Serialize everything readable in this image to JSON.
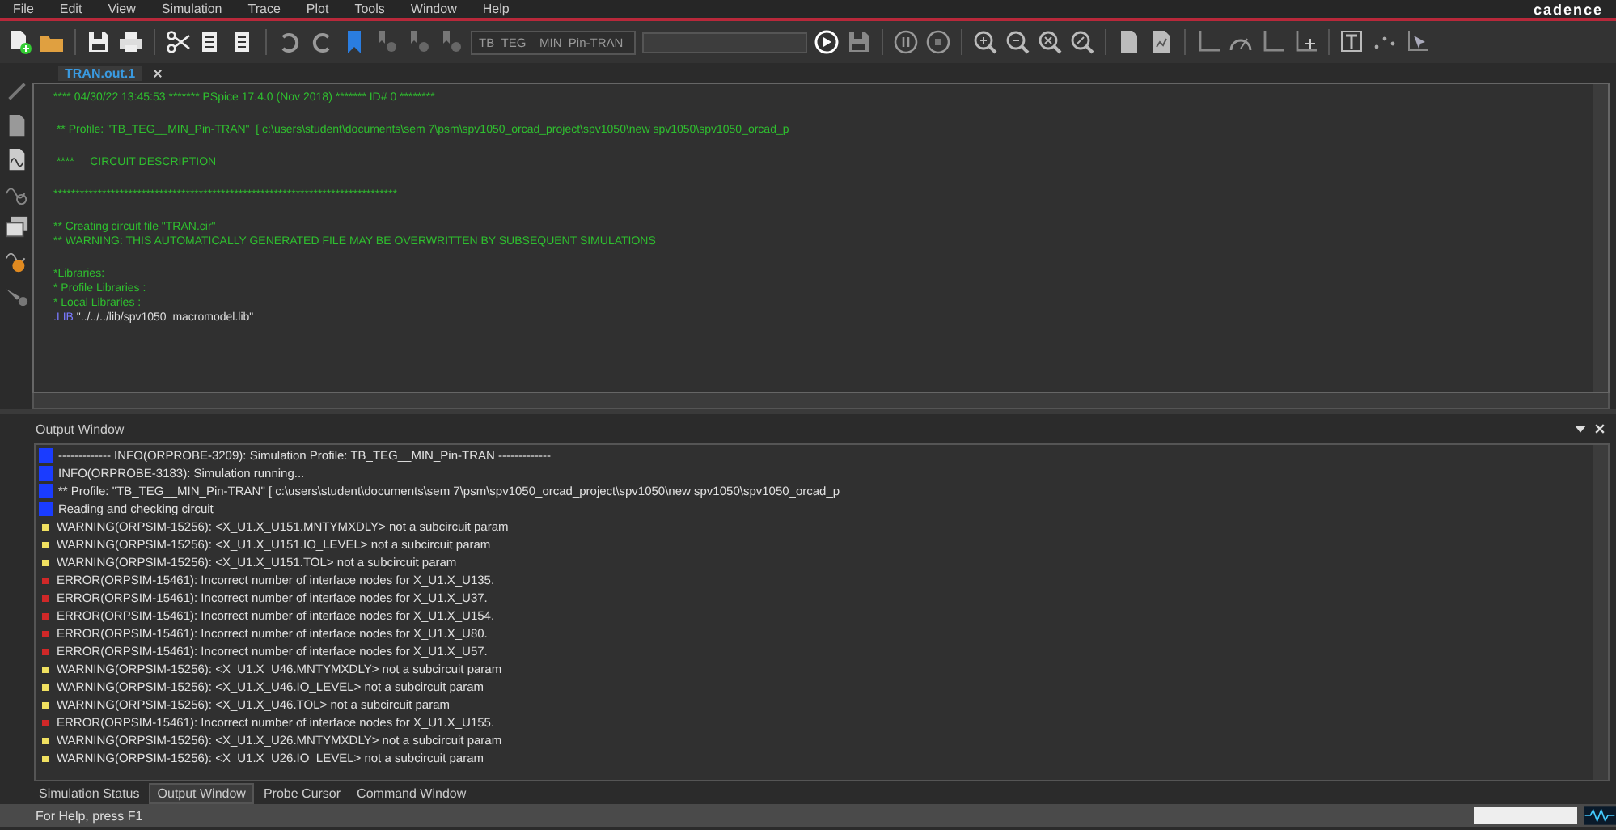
{
  "menu": [
    "File",
    "Edit",
    "View",
    "Simulation",
    "Trace",
    "Plot",
    "Tools",
    "Window",
    "Help"
  ],
  "logo": "cadence",
  "toolbar": {
    "profile": "TB_TEG__MIN_Pin-TRAN"
  },
  "document_tabs": [
    {
      "label": "TRAN.out.1",
      "selected": true
    }
  ],
  "editor": {
    "blocks": [
      [
        {
          "kind": "text",
          "text": "**** 04/30/22 13:45:53 ******* PSpice 17.4.0 (Nov 2018) ******* ID# 0 ********"
        }
      ],
      [
        {
          "kind": "text",
          "text": " ** Profile: \"TB_TEG__MIN_Pin-TRAN\"  [ c:\\users\\student\\documents\\sem 7\\psm\\spv1050_orcad_project\\spv1050\\new spv1050\\spv1050_orcad_p"
        }
      ],
      [
        {
          "kind": "text",
          "text": " ****     CIRCUIT DESCRIPTION"
        }
      ],
      [
        {
          "kind": "text",
          "text": "******************************************************************************"
        }
      ],
      [
        {
          "kind": "text",
          "text": "** Creating circuit file \"TRAN.cir\""
        },
        {
          "kind": "text",
          "text": "** WARNING: THIS AUTOMATICALLY GENERATED FILE MAY BE OVERWRITTEN BY SUBSEQUENT SIMULATIONS"
        }
      ],
      [
        {
          "kind": "text",
          "text": "*Libraries:"
        },
        {
          "kind": "text",
          "text": "* Profile Libraries :"
        },
        {
          "kind": "text",
          "text": "* Local Libraries :"
        },
        {
          "kind": "directive",
          "keyword": ".LIB",
          "text": "\"../../../lib/spv1050  macromodel.lib\""
        }
      ]
    ]
  },
  "output_window": {
    "title": "Output Window",
    "lines": [
      {
        "kind": "info",
        "text": "------------- INFO(ORPROBE-3209): Simulation Profile:  TB_TEG__MIN_Pin-TRAN -------------"
      },
      {
        "kind": "info",
        "text": "INFO(ORPROBE-3183): Simulation running..."
      },
      {
        "kind": "info",
        "text": "** Profile: \"TB_TEG__MIN_Pin-TRAN\"  [ c:\\users\\student\\documents\\sem 7\\psm\\spv1050_orcad_project\\spv1050\\new spv1050\\spv1050_orcad_p"
      },
      {
        "kind": "info",
        "text": "Reading and checking circuit"
      },
      {
        "kind": "warning",
        "text": "WARNING(ORPSIM-15256): <X_U1.X_U151.MNTYMXDLY> not a subcircuit param"
      },
      {
        "kind": "warning",
        "text": "WARNING(ORPSIM-15256): <X_U1.X_U151.IO_LEVEL> not a subcircuit param"
      },
      {
        "kind": "warning",
        "text": "WARNING(ORPSIM-15256): <X_U1.X_U151.TOL> not a subcircuit param"
      },
      {
        "kind": "error",
        "text": "ERROR(ORPSIM-15461): Incorrect number of interface nodes for X_U1.X_U135."
      },
      {
        "kind": "error",
        "text": "ERROR(ORPSIM-15461): Incorrect number of interface nodes for X_U1.X_U37."
      },
      {
        "kind": "error",
        "text": "ERROR(ORPSIM-15461): Incorrect number of interface nodes for X_U1.X_U154."
      },
      {
        "kind": "error",
        "text": "ERROR(ORPSIM-15461): Incorrect number of interface nodes for X_U1.X_U80."
      },
      {
        "kind": "error",
        "text": "ERROR(ORPSIM-15461): Incorrect number of interface nodes for X_U1.X_U57."
      },
      {
        "kind": "warning",
        "text": "WARNING(ORPSIM-15256): <X_U1.X_U46.MNTYMXDLY> not a subcircuit param"
      },
      {
        "kind": "warning",
        "text": "WARNING(ORPSIM-15256): <X_U1.X_U46.IO_LEVEL> not a subcircuit param"
      },
      {
        "kind": "warning",
        "text": "WARNING(ORPSIM-15256): <X_U1.X_U46.TOL> not a subcircuit param"
      },
      {
        "kind": "error",
        "text": "ERROR(ORPSIM-15461): Incorrect number of interface nodes for X_U1.X_U155."
      },
      {
        "kind": "warning",
        "text": "WARNING(ORPSIM-15256): <X_U1.X_U26.MNTYMXDLY> not a subcircuit param"
      },
      {
        "kind": "warning",
        "text": "WARNING(ORPSIM-15256): <X_U1.X_U26.IO_LEVEL> not a subcircuit param"
      }
    ]
  },
  "bottom_tabs": [
    {
      "label": "Simulation Status",
      "selected": false
    },
    {
      "label": "Output Window",
      "selected": true
    },
    {
      "label": "Probe Cursor",
      "selected": false
    },
    {
      "label": "Command Window",
      "selected": false
    }
  ],
  "status_bar": {
    "text": "For Help, press F1"
  }
}
